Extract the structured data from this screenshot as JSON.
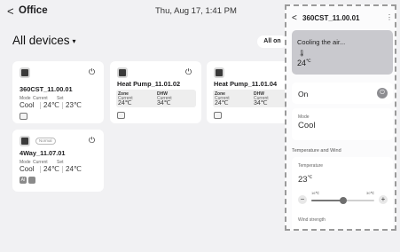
{
  "header": {
    "back_glyph": "<",
    "title": "Office",
    "datetime": "Thu, Aug 17, 1:41 PM"
  },
  "main": {
    "heading": "All devices",
    "heading_caret": "▾",
    "all_on_label": "All on"
  },
  "devices": [
    {
      "name": "360CST_11.00.01",
      "mode_label": "Mode",
      "current_label": "Current",
      "set_label": "Set",
      "mode": "Cool",
      "current": "24℃",
      "set": "23℃"
    },
    {
      "name": "Heat Pump_11.01.02",
      "zone_label": "Zone",
      "dhw_label": "DHW",
      "zone_current_label": "Current",
      "dhw_current_label": "Current",
      "zone": "24℃",
      "dhw": "34℃"
    },
    {
      "name": "Heat Pump_11.01.04",
      "zone_label": "Zone",
      "dhw_label": "DHW",
      "zone_current_label": "Current",
      "dhw_current_label": "Current",
      "zone": "24℃",
      "dhw": "34℃"
    },
    {
      "name": "4Way_11.07.01",
      "badge": "Normal",
      "mode_label": "Mode",
      "current_label": "Current",
      "set_label": "Set",
      "mode": "Cool",
      "current": "24℃",
      "set": "24℃",
      "icon1": "AI",
      "icon2": ""
    }
  ],
  "power_glyph": "⏻",
  "panel": {
    "back_glyph": "<",
    "title": "360CST_11.00.01",
    "more_glyph": "⋮",
    "status_text": "Cooling the air...",
    "status_icon": "🌡",
    "status_temp": "24",
    "status_unit": "℃",
    "on_label": "On",
    "toggle_glyph": "⏻",
    "mode_label": "Mode",
    "mode_value": "Cool",
    "section_label": "Temperature and Wind",
    "temperature_label": "Temperature",
    "temperature_value": "23",
    "temperature_unit": "℃",
    "min_label": "16℃",
    "max_label": "30℃",
    "slider_fraction": 0.5,
    "minus_label": "−",
    "plus_label": "+",
    "wind_label": "Wind strength"
  },
  "colors": {
    "background": "#f1f1f3",
    "panel_border": "#9a9a9a",
    "status_card": "#c9c9ce",
    "toggle": "#8d8d91"
  }
}
